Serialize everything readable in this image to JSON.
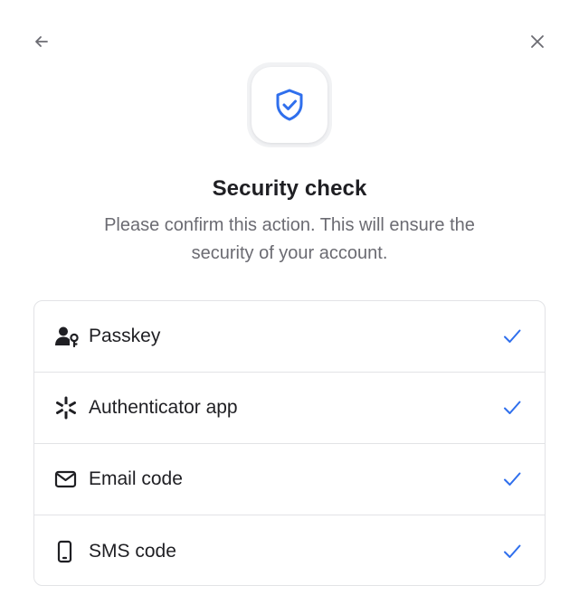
{
  "header": {
    "back_icon": "arrow-left-icon",
    "close_icon": "close-icon"
  },
  "badge": {
    "icon": "shield-check-icon",
    "accent_color": "#2f6fed"
  },
  "title": "Security check",
  "subtitle": "Please confirm this action. This will ensure the security of your account.",
  "methods": [
    {
      "label": "Passkey",
      "icon": "user-key-icon",
      "selected": true
    },
    {
      "label": "Authenticator app",
      "icon": "asterisk-icon",
      "selected": true
    },
    {
      "label": "Email code",
      "icon": "mail-icon",
      "selected": true
    },
    {
      "label": "SMS code",
      "icon": "phone-icon",
      "selected": true
    }
  ],
  "colors": {
    "check": "#2f6fed",
    "text_primary": "#1f1f23",
    "text_secondary": "#6b6b72",
    "border": "#e2e3e6"
  }
}
